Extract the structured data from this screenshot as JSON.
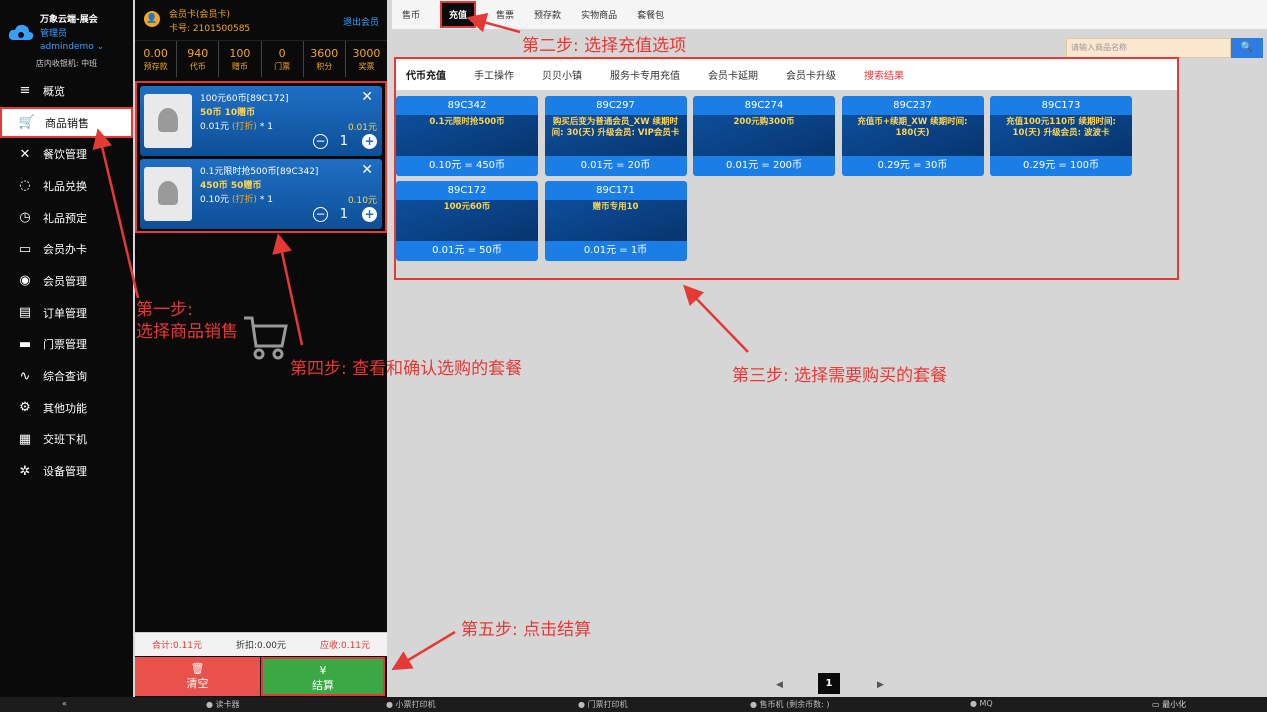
{
  "brand": {
    "name": "万象云端-展会",
    "role": "管理员",
    "user": "admindemo ⌄",
    "shift": "店内收银机: 中班"
  },
  "nav": [
    {
      "label": "概览",
      "icon": "≡",
      "name": "menu-icon"
    },
    {
      "label": "商品销售",
      "icon": "🛒",
      "name": "cart-icon"
    },
    {
      "label": "餐饮管理",
      "icon": "✕",
      "name": "utensils-icon"
    },
    {
      "label": "礼品兑换",
      "icon": "◌",
      "name": "gift-icon"
    },
    {
      "label": "礼品预定",
      "icon": "◷",
      "name": "clock-icon"
    },
    {
      "label": "会员办卡",
      "icon": "▭",
      "name": "card-icon"
    },
    {
      "label": "会员管理",
      "icon": "◉",
      "name": "user-icon"
    },
    {
      "label": "订单管理",
      "icon": "▤",
      "name": "clipboard-icon"
    },
    {
      "label": "门票管理",
      "icon": "▬",
      "name": "ticket-icon"
    },
    {
      "label": "综合查询",
      "icon": "∿",
      "name": "pulse-icon"
    },
    {
      "label": "其他功能",
      "icon": "⚙",
      "name": "misc-icon"
    },
    {
      "label": "交班下机",
      "icon": "▦",
      "name": "calculator-icon"
    },
    {
      "label": "设备管理",
      "icon": "✲",
      "name": "gear-icon"
    }
  ],
  "member": {
    "card_type": "会员卡(会员卡)",
    "card_no": "卡号: 2101500585",
    "exit": "退出会员"
  },
  "stats": [
    {
      "value": "0.00",
      "label": "预存款"
    },
    {
      "value": "940",
      "label": "代币"
    },
    {
      "value": "100",
      "label": "赠币"
    },
    {
      "value": "0",
      "label": "门票"
    },
    {
      "value": "3600",
      "label": "积分"
    },
    {
      "value": "3000",
      "label": "奖票"
    }
  ],
  "cart_items": [
    {
      "name": "100元60币[89C172]",
      "sub": "50币 10赠币",
      "price": "0.01元",
      "discount": "(打折)",
      "mult": "* 1",
      "total": "0.01元",
      "qty": "1"
    },
    {
      "name": "0.1元限时抢500币[89C342]",
      "sub": "450币 50赠币",
      "price": "0.10元",
      "discount": "(打折)",
      "mult": "* 1",
      "total": "0.10元",
      "qty": "1"
    }
  ],
  "summary": {
    "total": "合计:0.11元",
    "discount": "折扣:0.00元",
    "due": "应收:0.11元"
  },
  "buttons": {
    "clear_icon": "🗑",
    "clear": "清空",
    "pay_icon": "¥",
    "pay": "结算"
  },
  "top_tabs": [
    "售币",
    "充值",
    "售票",
    "预存款",
    "实物商品",
    "套餐包"
  ],
  "search_placeholder": "请输入商品名称",
  "search_icon": "🔍",
  "sub_tabs": [
    "代币充值",
    "手工操作",
    "贝贝小镇",
    "服务卡专用充值",
    "会员卡延期",
    "会员卡升级",
    "搜索结果"
  ],
  "packages": [
    {
      "id": "89C342",
      "desc": "0.1元限时抢500币",
      "rate": "0.10元 = 450币"
    },
    {
      "id": "89C297",
      "desc": "购买后变为普通会员_XW 续期时间: 30(天) 升级会员: VIP会员卡",
      "rate": "0.01元 = 20币"
    },
    {
      "id": "89C274",
      "desc": "200元购300币",
      "rate": "0.01元 = 200币"
    },
    {
      "id": "89C237",
      "desc": "充值币+续期_XW 续期时间: 180(天)",
      "rate": "0.29元 = 30币"
    },
    {
      "id": "89C173",
      "desc": "充值100元110币 续期时间: 10(天) 升级会员: 波波卡",
      "rate": "0.29元 = 100币"
    },
    {
      "id": "89C172",
      "desc": "100元60币",
      "rate": "0.01元 = 50币"
    },
    {
      "id": "89C171",
      "desc": "赠币专用10",
      "rate": "0.01元 = 1币"
    }
  ],
  "annotations": {
    "step1": "第一步:\n选择商品销售",
    "step2": "第二步: 选择充值选项",
    "step3": "第三步: 选择需要购买的套餐",
    "step4": "第四步: 查看和确认选购的套餐",
    "step5": "第五步: 点击结算"
  },
  "pager": {
    "prev": "◀",
    "current": "1",
    "next": "▶"
  },
  "statusbar": {
    "collapse": "«",
    "reader": "● 读卡器",
    "ticket_printer": "● 小票打印机",
    "gate_printer": "● 门票打印机",
    "coin_machine": "● 售币机 (剩余币数: )",
    "mq": "● MQ",
    "minimize": "▭ 最小化"
  },
  "colors": {
    "accent": "#1a7ee6",
    "alert": "#e53935",
    "gold": "#f5a623",
    "pay": "#3aa843",
    "clear": "#e8524a"
  }
}
